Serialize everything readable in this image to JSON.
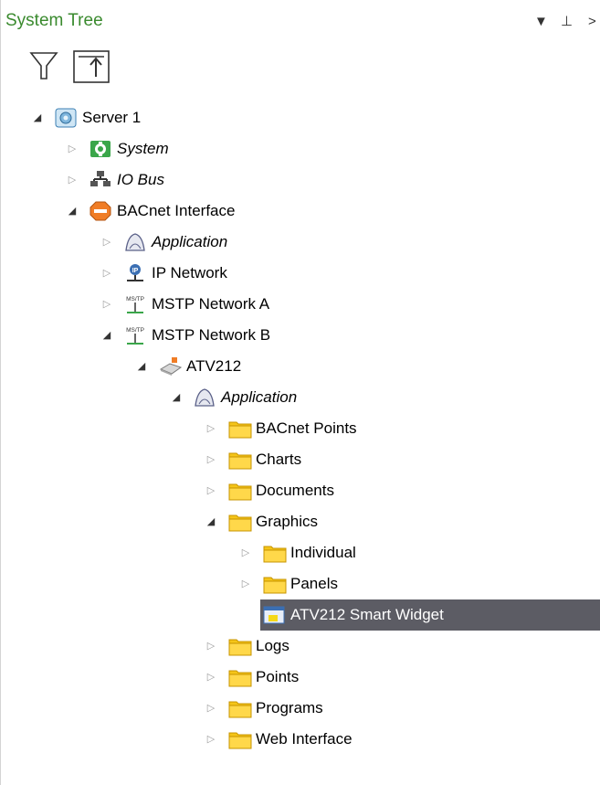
{
  "panel": {
    "title": "System Tree",
    "header_buttons": {
      "dropdown": "▼",
      "pin": "⊥",
      "close": ">"
    }
  },
  "toolbar": {
    "filter_icon": "filter-icon",
    "collapse_icon": "collapse-to-top-icon"
  },
  "tree": [
    {
      "label": "Server 1",
      "italic": false,
      "state": "open",
      "icon": "server-icon",
      "level": 0
    },
    {
      "label": "System",
      "italic": true,
      "state": "closed",
      "icon": "system-gear-icon",
      "level": 1
    },
    {
      "label": "IO Bus",
      "italic": true,
      "state": "closed",
      "icon": "io-bus-icon",
      "level": 1
    },
    {
      "label": "BACnet Interface",
      "italic": false,
      "state": "open",
      "icon": "bacnet-interface-icon",
      "level": 1
    },
    {
      "label": "Application",
      "italic": true,
      "state": "closed",
      "icon": "application-icon",
      "level": 2
    },
    {
      "label": "IP Network",
      "italic": false,
      "state": "closed",
      "icon": "ip-network-icon",
      "level": 2
    },
    {
      "label": "MSTP Network A",
      "italic": false,
      "state": "closed",
      "icon": "mstp-network-icon",
      "level": 2
    },
    {
      "label": "MSTP Network B",
      "italic": false,
      "state": "open",
      "icon": "mstp-network-icon",
      "level": 2
    },
    {
      "label": "ATV212",
      "italic": false,
      "state": "open",
      "icon": "device-icon",
      "level": 3
    },
    {
      "label": "Application",
      "italic": true,
      "state": "open",
      "icon": "application-icon",
      "level": 4
    },
    {
      "label": "BACnet Points",
      "italic": false,
      "state": "closed",
      "icon": "folder-icon",
      "level": 5
    },
    {
      "label": "Charts",
      "italic": false,
      "state": "closed",
      "icon": "folder-icon",
      "level": 5
    },
    {
      "label": "Documents",
      "italic": false,
      "state": "closed",
      "icon": "folder-icon",
      "level": 5
    },
    {
      "label": "Graphics",
      "italic": false,
      "state": "open",
      "icon": "folder-icon",
      "level": 5
    },
    {
      "label": "Individual",
      "italic": false,
      "state": "closed",
      "icon": "folder-icon",
      "level": 6
    },
    {
      "label": "Panels",
      "italic": false,
      "state": "closed",
      "icon": "folder-icon",
      "level": 6
    },
    {
      "label": "ATV212 Smart Widget",
      "italic": false,
      "state": "none",
      "icon": "widget-icon",
      "level": 6,
      "selected": true
    },
    {
      "label": "Logs",
      "italic": false,
      "state": "closed",
      "icon": "folder-icon",
      "level": 5
    },
    {
      "label": "Points",
      "italic": false,
      "state": "closed",
      "icon": "folder-icon",
      "level": 5
    },
    {
      "label": "Programs",
      "italic": false,
      "state": "closed",
      "icon": "folder-icon",
      "level": 5
    },
    {
      "label": "Web Interface",
      "italic": false,
      "state": "closed",
      "icon": "folder-icon",
      "level": 5
    }
  ],
  "colors": {
    "title": "#3a8a2e",
    "selection": "#5c5c64",
    "folder": "#f5c518"
  }
}
